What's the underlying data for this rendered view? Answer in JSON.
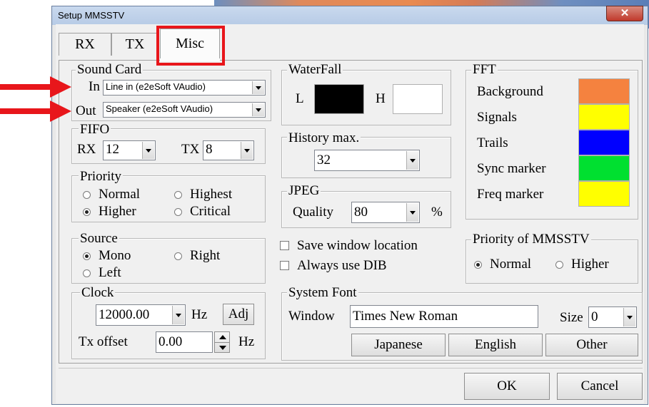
{
  "window": {
    "title": "Setup MMSSTV",
    "close_glyph": "✕"
  },
  "tabs": [
    {
      "label": "RX"
    },
    {
      "label": "TX"
    },
    {
      "label": "Misc"
    }
  ],
  "sound_card": {
    "label": "Sound Card",
    "in_label": "In",
    "in_value": "Line in (e2eSoft VAudio)",
    "out_label": "Out",
    "out_value": "Speaker (e2eSoft VAudio)"
  },
  "fifo": {
    "label": "FIFO",
    "rx_label": "RX",
    "rx_value": "12",
    "tx_label": "TX",
    "tx_value": "8"
  },
  "priority": {
    "label": "Priority",
    "options": [
      {
        "label": "Normal",
        "selected": false
      },
      {
        "label": "Highest",
        "selected": false
      },
      {
        "label": "Higher",
        "selected": true
      },
      {
        "label": "Critical",
        "selected": false
      }
    ]
  },
  "source": {
    "label": "Source",
    "options": [
      {
        "label": "Mono",
        "selected": true
      },
      {
        "label": "Right",
        "selected": false
      },
      {
        "label": "Left",
        "selected": false
      }
    ]
  },
  "clock": {
    "label": "Clock",
    "value": "12000.00",
    "unit": "Hz",
    "adj_label": "Adj",
    "tx_offset_label": "Tx offset",
    "tx_offset_value": "0.00",
    "tx_offset_unit": "Hz"
  },
  "waterfall": {
    "label": "WaterFall",
    "l_label": "L",
    "h_label": "H",
    "l_color": "#000000",
    "h_color": "#ffffff"
  },
  "history": {
    "label": "History max.",
    "value": "32"
  },
  "jpeg": {
    "label": "JPEG",
    "quality_label": "Quality",
    "quality_value": "80",
    "unit": "%"
  },
  "options": {
    "save_window_location": "Save window location",
    "always_use_dib": "Always use DIB"
  },
  "fft": {
    "label": "FFT",
    "items": [
      {
        "label": "Background",
        "color": "#f5823f"
      },
      {
        "label": "Signals",
        "color": "#ffff00"
      },
      {
        "label": "Trails",
        "color": "#0000ff"
      },
      {
        "label": "Sync marker",
        "color": "#00e030"
      },
      {
        "label": "Freq marker",
        "color": "#ffff00"
      }
    ]
  },
  "app_priority": {
    "label": "Priority of MMSSTV",
    "options": [
      {
        "label": "Normal",
        "selected": true
      },
      {
        "label": "Higher",
        "selected": false
      }
    ]
  },
  "system_font": {
    "label": "System Font",
    "window_label": "Window",
    "window_value": "Times New Roman",
    "size_label": "Size",
    "size_value": "0",
    "buttons": [
      "Japanese",
      "English",
      "Other"
    ]
  },
  "footer": {
    "ok": "OK",
    "cancel": "Cancel"
  }
}
